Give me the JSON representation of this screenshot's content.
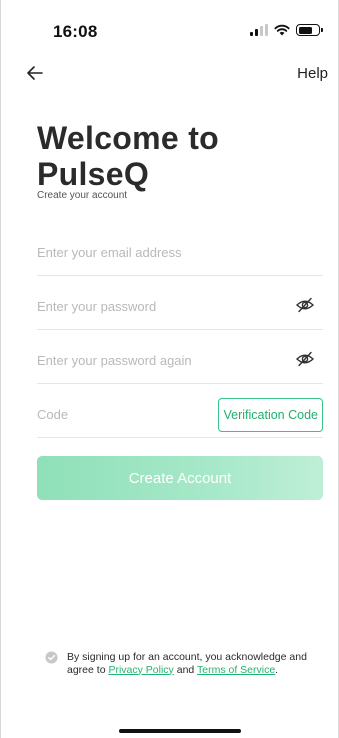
{
  "status_bar": {
    "time": "16:08"
  },
  "nav": {
    "help_label": "Help"
  },
  "header": {
    "title_line1": "Welcome to",
    "title_line2": "PulseQ",
    "subtitle": "Create your account"
  },
  "form": {
    "email": {
      "value": "",
      "placeholder": "Enter your email address"
    },
    "password": {
      "value": "",
      "placeholder": "Enter your password"
    },
    "password_confirm": {
      "value": "",
      "placeholder": "Enter your password again"
    },
    "code": {
      "value": "",
      "placeholder": "Code"
    },
    "verification_button": "Verification Code",
    "submit_label": "Create Account"
  },
  "agreement": {
    "text_before": "By signing up for an account, you acknowledge and agree to ",
    "privacy_link": "Privacy Policy",
    "text_between": " and ",
    "terms_link": "Terms of Service",
    "text_after": "."
  },
  "colors": {
    "accent": "#36c48a",
    "button_fill": "#a6e8c9",
    "link": "#22b371"
  },
  "icons": [
    "back-arrow-icon",
    "eye-off-icon",
    "check-circle-icon",
    "signal-icon",
    "wifi-icon",
    "battery-icon"
  ]
}
